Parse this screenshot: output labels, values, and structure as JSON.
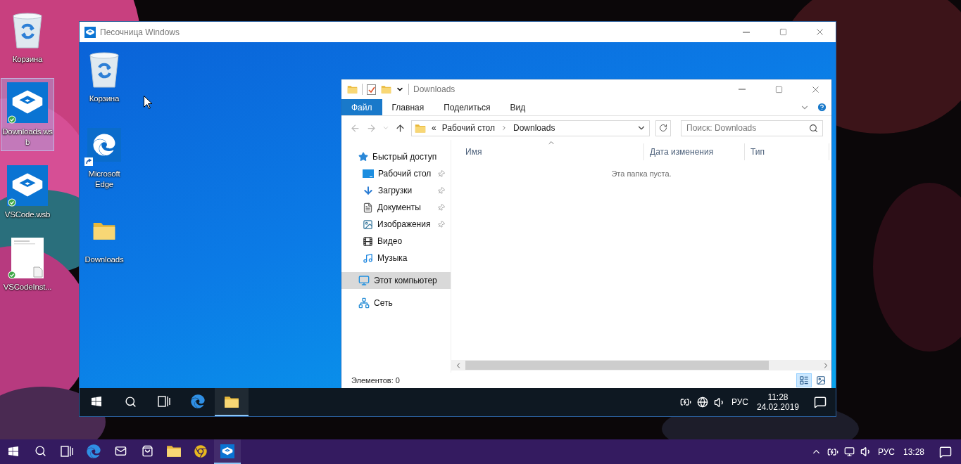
{
  "desktop": {
    "icons": [
      {
        "label": "Корзина",
        "kind": "recycle",
        "selected": false,
        "synced": false
      },
      {
        "label": "Downloads.wsb",
        "kind": "sandbox",
        "selected": true,
        "synced": true
      },
      {
        "label": "VSCode.wsb",
        "kind": "sandbox",
        "selected": false,
        "synced": true
      },
      {
        "label": "VSCodeInst...",
        "kind": "document",
        "selected": false,
        "synced": true
      }
    ]
  },
  "sandbox_window": {
    "title": "Песочница Windows",
    "desktop_icons": [
      {
        "label": "Корзина",
        "kind": "recycle",
        "shortcut": false
      },
      {
        "label": "Microsoft Edge",
        "kind": "edge",
        "shortcut": true
      },
      {
        "label": "Downloads",
        "kind": "folder",
        "shortcut": false
      }
    ],
    "explorer": {
      "title": "Downloads",
      "ribbon_tabs": [
        {
          "label": "Файл",
          "selected": true
        },
        {
          "label": "Главная",
          "selected": false
        },
        {
          "label": "Поделиться",
          "selected": false
        },
        {
          "label": "Вид",
          "selected": false
        }
      ],
      "address": {
        "overflow": "«",
        "path": [
          "Рабочий стол",
          "Downloads"
        ]
      },
      "search": {
        "placeholder": "Поиск: Downloads"
      },
      "columns": [
        "Имя",
        "Дата изменения",
        "Тип"
      ],
      "empty_message": "Эта папка пуста.",
      "navigation": [
        {
          "label": "Быстрый доступ",
          "kind": "star",
          "selected": false,
          "children": [
            {
              "label": "Рабочий стол",
              "kind": "desktop",
              "selected": false,
              "pinned": true
            },
            {
              "label": "Загрузки",
              "kind": "downloads",
              "selected": false,
              "pinned": true
            },
            {
              "label": "Документы",
              "kind": "documents",
              "selected": false,
              "pinned": true
            },
            {
              "label": "Изображения",
              "kind": "pictures",
              "selected": false,
              "pinned": true
            },
            {
              "label": "Видео",
              "kind": "video",
              "selected": false,
              "pinned": false
            },
            {
              "label": "Музыка",
              "kind": "music",
              "selected": false,
              "pinned": false
            }
          ]
        },
        {
          "label": "Этот компьютер",
          "kind": "computer",
          "selected": true
        },
        {
          "label": "Сеть",
          "kind": "network",
          "selected": false
        }
      ],
      "status": "Элементов: 0",
      "views": [
        {
          "kind": "details",
          "selected": true
        },
        {
          "kind": "tiles",
          "selected": false
        }
      ]
    },
    "taskbar": {
      "items": [
        {
          "kind": "start",
          "selected": false
        },
        {
          "kind": "search",
          "selected": false
        },
        {
          "kind": "taskview",
          "selected": false
        },
        {
          "kind": "edge",
          "selected": false
        },
        {
          "kind": "explorer",
          "selected": true
        }
      ],
      "tray": [
        {
          "kind": "power"
        },
        {
          "kind": "globe"
        },
        {
          "kind": "volume"
        }
      ],
      "language": "РУС",
      "time": "11:28",
      "date": "24.02.2019"
    }
  },
  "taskbar": {
    "items": [
      {
        "kind": "start",
        "selected": false
      },
      {
        "kind": "search",
        "selected": false
      },
      {
        "kind": "taskview",
        "selected": false
      },
      {
        "kind": "edge",
        "selected": false
      },
      {
        "kind": "mail",
        "selected": false
      },
      {
        "kind": "store",
        "selected": false
      },
      {
        "kind": "explorer",
        "selected": false
      },
      {
        "kind": "chrome",
        "selected": false
      },
      {
        "kind": "sandbox",
        "selected": true
      }
    ],
    "tray": [
      {
        "kind": "chevron"
      },
      {
        "kind": "power"
      },
      {
        "kind": "monitor"
      },
      {
        "kind": "volume"
      }
    ],
    "language": "РУС",
    "time": "13:28"
  }
}
